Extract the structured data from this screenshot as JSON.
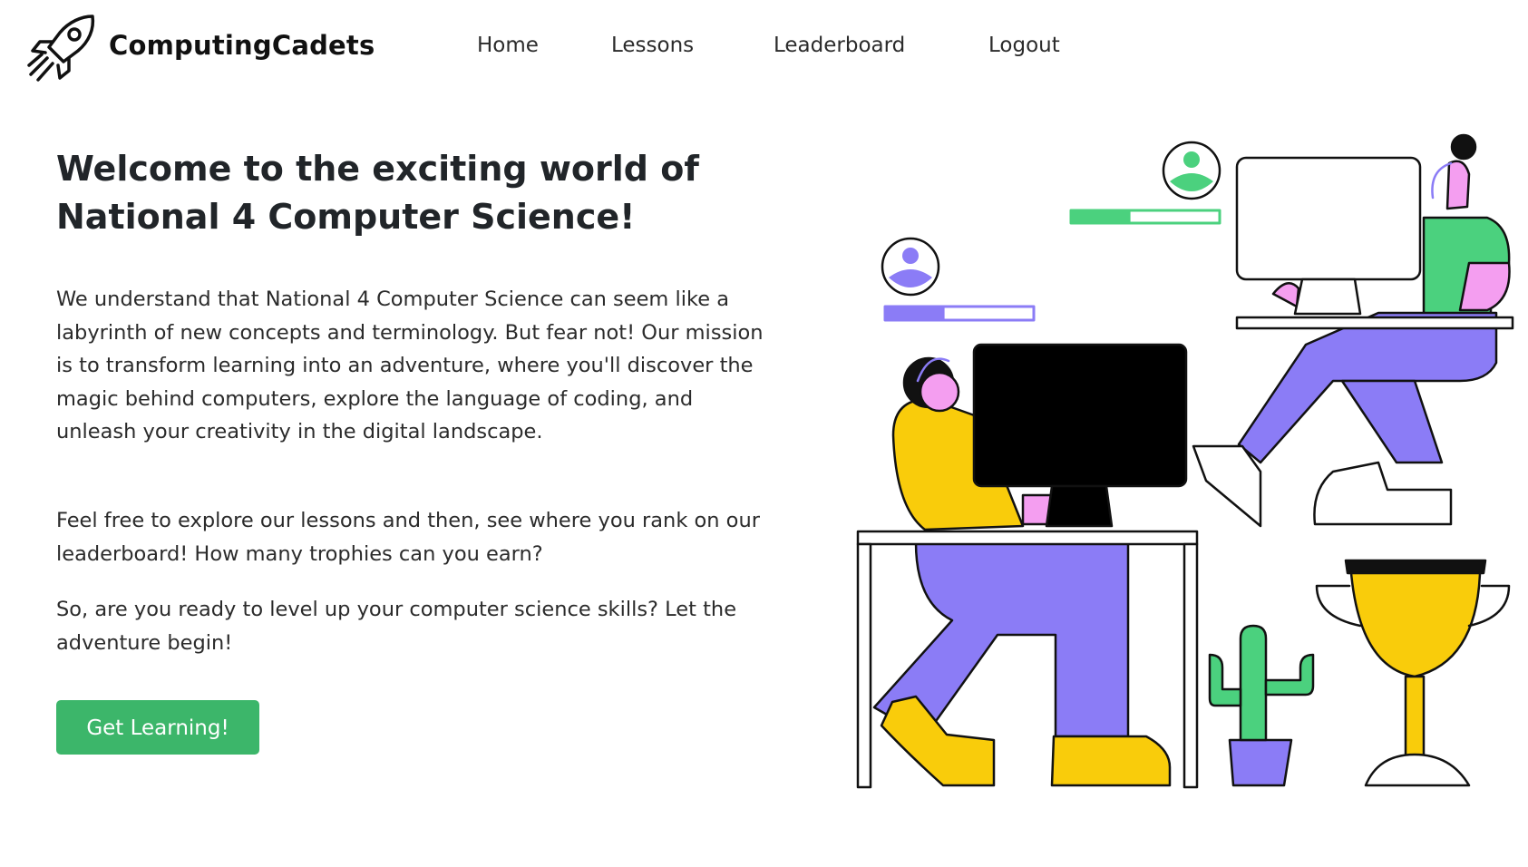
{
  "nav": {
    "brand": "ComputingCadets",
    "brand_icon": "rocket-icon",
    "links": [
      "Home",
      "Lessons",
      "Leaderboard",
      "Logout"
    ]
  },
  "hero": {
    "title": "Welcome to the exciting world of National 4 Computer Science!",
    "paragraphs": [
      "We understand that National 4 Computer Science can seem like a labyrinth of new concepts and terminology. But fear not! Our mission is to transform learning into an adventure, where you'll discover the magic behind computers, explore the language of coding, and unleash your creativity in the digital landscape.",
      "Feel free to explore our lessons and then, see where you rank on our leaderboard! How many trophies can you earn?",
      "So, are you ready to level up your computer science skills? Let the adventure begin!"
    ],
    "cta_label": "Get Learning!"
  },
  "colors": {
    "accent_green": "#3cb66a",
    "purple": "#8b7cf6",
    "pink": "#f49ef0",
    "yellow": "#f9cc0b",
    "green": "#4bd17e"
  },
  "progress": {
    "top_profile_fill": 0.4,
    "left_profile_fill": 0.4
  }
}
